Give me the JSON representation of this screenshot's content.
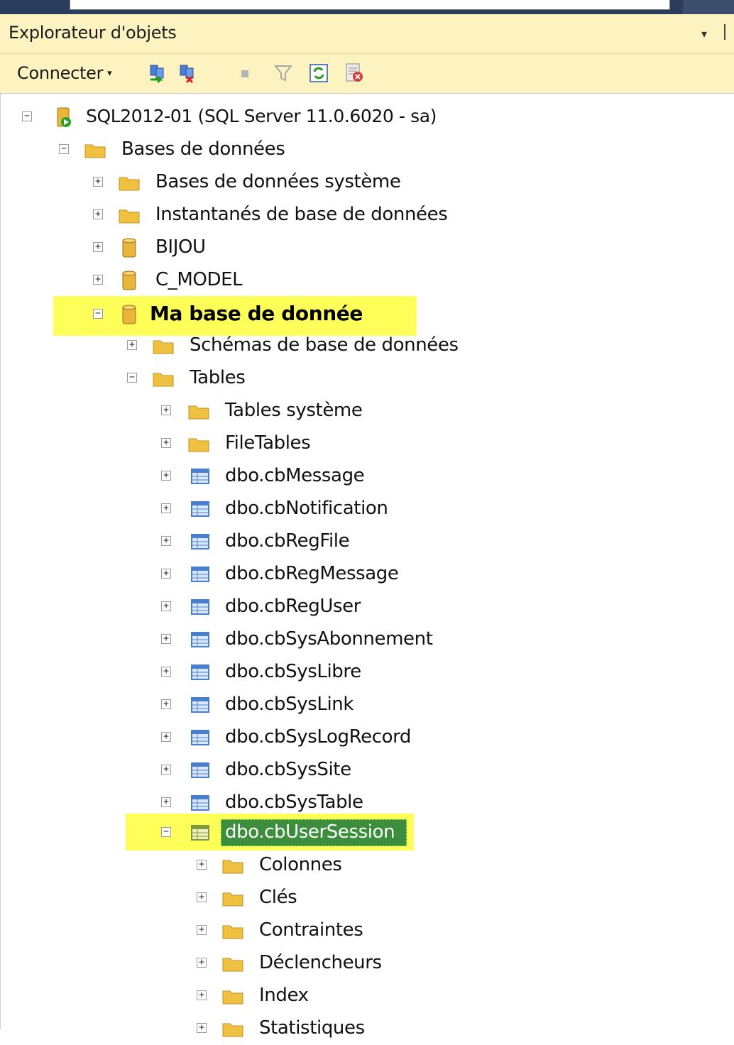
{
  "panel": {
    "title": "Explorateur d'objets",
    "arrow": "▾"
  },
  "toolbar": {
    "connect_label": "Connecter",
    "connect_caret": "▾",
    "icons": [
      "connect-icon",
      "disconnect-icon",
      "stop-icon",
      "filter-icon",
      "refresh-icon",
      "activity-icon"
    ]
  },
  "tree": {
    "expand_glyph": "+",
    "collapse_glyph": "−",
    "server": "SQL2012-01 (SQL Server 11.0.6020 - sa)",
    "databases": "Bases de données",
    "system_databases": "Bases de données système",
    "snapshots": "Instantanés de base de données",
    "db_bijou": "BIJOU",
    "db_cmodel": "C_MODEL",
    "db_mine": "Ma base de donnée",
    "schemas": "Schémas de base de données",
    "tables": "Tables",
    "system_tables": "Tables système",
    "file_tables": "FileTables",
    "table_items": [
      "dbo.cbMessage",
      "dbo.cbNotification",
      "dbo.cbRegFile",
      "dbo.cbRegMessage",
      "dbo.cbRegUser",
      "dbo.cbSysAbonnement",
      "dbo.cbSysLibre",
      "dbo.cbSysLink",
      "dbo.cbSysLogRecord",
      "dbo.cbSysSite",
      "dbo.cbSysTable"
    ],
    "selected_table": "dbo.cbUserSession",
    "subfolders": [
      "Colonnes",
      "Clés",
      "Contraintes",
      "Déclencheurs",
      "Index",
      "Statistiques"
    ]
  },
  "colors": {
    "header_bg": "#fdf3c0",
    "highlight": "#ffff5a",
    "selection": "#3c8e3c",
    "folder": "#f0c040",
    "database": "#e9b53a",
    "table": "#4a7fd0"
  }
}
